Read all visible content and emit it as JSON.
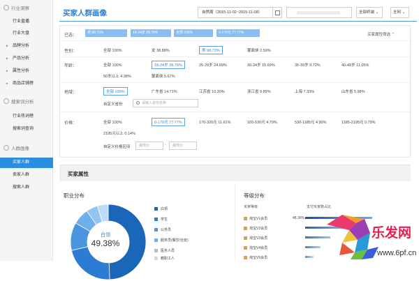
{
  "sidebar": {
    "sections": [
      {
        "title": "行业洞察",
        "items": [
          {
            "label": "行业直播",
            "arrow": false
          },
          {
            "label": "行业大盘",
            "arrow": false
          },
          {
            "label": "品牌分析",
            "arrow": true
          },
          {
            "label": "产品分析",
            "arrow": true
          },
          {
            "label": "属性分析",
            "arrow": true
          },
          {
            "label": "商品店铺榜",
            "arrow": true
          }
        ]
      },
      {
        "title": "搜索词分析",
        "items": [
          {
            "label": "行业热词榜",
            "arrow": false
          },
          {
            "label": "搜索词查询",
            "arrow": false
          }
        ]
      },
      {
        "title": "人群画像",
        "items": [
          {
            "label": "买家人群",
            "arrow": false,
            "active": true
          },
          {
            "label": "卖家人群",
            "arrow": false
          },
          {
            "label": "搜索人群",
            "arrow": false
          }
        ]
      }
    ]
  },
  "header": {
    "title": "买家人群画像",
    "date_range": "自然周（2015-11-02~2015-11-08）",
    "terminal_select": "全部终端",
    "site_select": "全网"
  },
  "selected": {
    "label": "已选：",
    "tags": [
      "男 98.73%",
      "18-24岁 28.79%",
      "全部 100%",
      "0-170元 77.77%"
    ],
    "more_label": "买家属性筛选"
  },
  "filters": {
    "gender": {
      "label": "性别：",
      "options": [
        "全部 100%",
        "女 38.88%",
        "男 98.73%",
        "蒙面侠 2.59%"
      ]
    },
    "age": {
      "label": "年龄：",
      "options": [
        "全部 100%",
        "18-24岁 28.79%",
        "25-29岁 24.69%",
        "30-34岁 15.69%",
        "35-39岁 9.72%",
        "40-49岁 11.05%",
        "50岁以上 4.38%",
        "蒙面侠 5.67%"
      ]
    },
    "region": {
      "label": "地域：",
      "options": [
        "全部 100%",
        "广东省 14.71%",
        "江苏省 10.30%",
        "浙江省 9.89%",
        "上海 7.33%",
        "山东省 5.98%"
      ],
      "custom_label": "自定义省份",
      "custom_placeholder": "请输入省份名称"
    },
    "price": {
      "label": "价格：",
      "options": [
        "全部 100%",
        "0-170元 77.77%",
        "170-320元 11.61%",
        "320-530元 4.79%",
        "530-1185元 4.90%",
        "1185-2195元 0.79%",
        "2195元以上 0.14%"
      ],
      "custom_label": "自定义价格区间",
      "min_placeholder": "最低价",
      "max_placeholder": "最低价"
    }
  },
  "attributes": {
    "band_title": "买家属性",
    "occupation": {
      "title": "职业分布",
      "center_label": "白领",
      "center_value": "49.38%",
      "legend": [
        "白领",
        "学生",
        "公务员",
        "服务员(餐饮/治安)",
        "医务人员",
        "教职工人"
      ]
    },
    "level": {
      "title": "等级分布",
      "col_level": "买家等级",
      "col_share": "支付买家数占比",
      "rows": [
        {
          "label": "淘宝V1会员",
          "value": "48.30%"
        },
        {
          "label": "淘宝V2会员",
          "value": ""
        },
        {
          "label": "淘宝V3会员",
          "value": ""
        },
        {
          "label": "淘宝V4会员",
          "value": ""
        },
        {
          "label": "淘宝V5会员",
          "value": ""
        }
      ]
    }
  },
  "watermark": {
    "brand": "乐发网",
    "url": "www.6pf.cn"
  },
  "colors": {
    "accent": "#2e7fd4",
    "active_nav": "#2a8ee0",
    "tag_bg": "#8bbcf0",
    "donut_main": "#1a66b8"
  }
}
